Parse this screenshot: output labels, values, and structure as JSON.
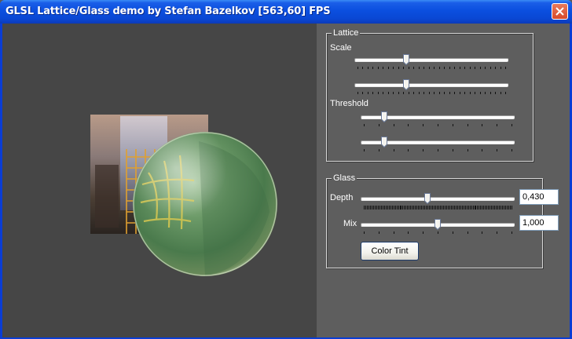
{
  "window": {
    "title": "GLSL Lattice/Glass demo by Stefan Bazelkov [563,60] FPS"
  },
  "lattice": {
    "group_label": "Lattice",
    "scale_label": "Scale",
    "threshold_label": "Threshold",
    "sliders": [
      {
        "name": "scale-slider-1",
        "value": 0.33
      },
      {
        "name": "scale-slider-2",
        "value": 0.33
      },
      {
        "name": "threshold-slider-1",
        "value": 0.14
      },
      {
        "name": "threshold-slider-2",
        "value": 0.14
      }
    ]
  },
  "glass": {
    "group_label": "Glass",
    "depth_label": "Depth",
    "depth_value": "0,430",
    "depth_slider": 0.43,
    "mix_label": "Mix",
    "mix_value": "1,000",
    "mix_slider": 0.5,
    "color_tint_label": "Color Tint"
  },
  "colors": {
    "titlebar": "#0a47d3",
    "viewport_bg": "#464646",
    "panel_bg": "#5e5e5e",
    "glass_green": "#5a8a55"
  }
}
